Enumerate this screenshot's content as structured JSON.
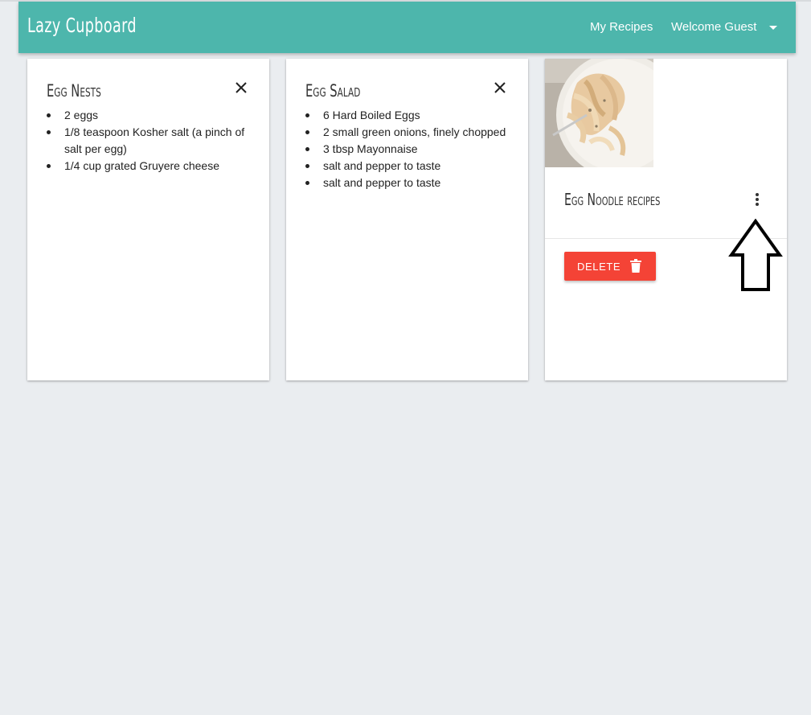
{
  "app": {
    "brand": "Lazy Cupboard"
  },
  "nav": {
    "my_recipes": "My Recipes",
    "welcome": "Welcome Guest"
  },
  "cards": [
    {
      "title": "Egg Nests",
      "ingredients": [
        "2 eggs",
        "1/8 teaspoon Kosher salt (a pinch of salt per egg)",
        "1/4 cup grated Gruyere cheese"
      ]
    },
    {
      "title": "Egg Salad",
      "ingredients": [
        "6 Hard Boiled Eggs",
        "2 small green onions, finely chopped",
        "3 tbsp Mayonnaise",
        "salt and pepper to taste",
        "salt and pepper to taste"
      ]
    },
    {
      "title": "Egg Noodle recipes",
      "delete_label": "DELETE"
    }
  ],
  "icons": {
    "close": "close-icon",
    "more": "more-vertical-icon",
    "trash": "trash-icon",
    "caret": "caret-down-icon",
    "arrow": "arrow-up-icon"
  },
  "colors": {
    "navbar": "#4db6ac",
    "background": "#eaedf0",
    "delete_button": "#f44336"
  }
}
